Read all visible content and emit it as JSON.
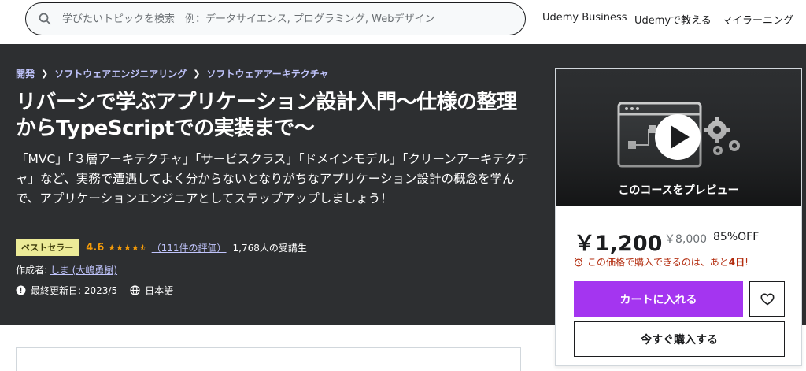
{
  "header": {
    "search_placeholder": "学びたいトピックを検索　例：データサイエンス, プログラミング, Webデザイン",
    "nav": [
      "Udemy Business",
      "Udemyで教える",
      "マイラーニング"
    ]
  },
  "breadcrumb": [
    "開発",
    "ソフトウェアエンジニアリング",
    "ソフトウェアアーキテクチャ"
  ],
  "course": {
    "title": "リバーシで学ぶアプリケーション設計入門〜仕様の整理からTypeScriptでの実装まで〜",
    "description": "「MVC」「３層アーキテクチャ」「サービスクラス」「ドメインモデル」「クリーンアーキテクチャ」など、実務で遭遇してよく分からないとなりがちなアプリケーション設計の概念を学んで、アプリケーションエンジニアとしてステップアップしましょう！",
    "badge": "ベストセラー",
    "rating": "4.6",
    "rating_stars": 4.5,
    "rating_count": "（111件の評価）",
    "students": "1,768人の受講生",
    "author_label": "作成者: ",
    "author": "しま (大嶋勇樹)",
    "updated": "最終更新日: 2023/5",
    "language": "日本語"
  },
  "card": {
    "preview_label": "このコースをプレビュー",
    "price": "￥1,200",
    "original_price": "￥8,000",
    "discount": "85%OFF",
    "timer_prefix": "この価格で購入できるのは、あと",
    "timer_days": "4日",
    "timer_suffix": "!",
    "cart_label": "カートに入れる",
    "buy_label": "今すぐ購入する"
  },
  "colors": {
    "hero_bg": "#2d2f31",
    "accent_purple": "#a435f0",
    "link_lavender": "#c0c4fc",
    "star_orange": "#f69c08",
    "badge_bg": "#eceb98",
    "timer_red": "#b32d0f"
  },
  "icons": [
    "search-icon",
    "chevron-right-icon",
    "star-icon",
    "alert-badge-icon",
    "globe-icon",
    "alarm-clock-icon",
    "heart-icon",
    "play-icon",
    "gear-icon"
  ]
}
